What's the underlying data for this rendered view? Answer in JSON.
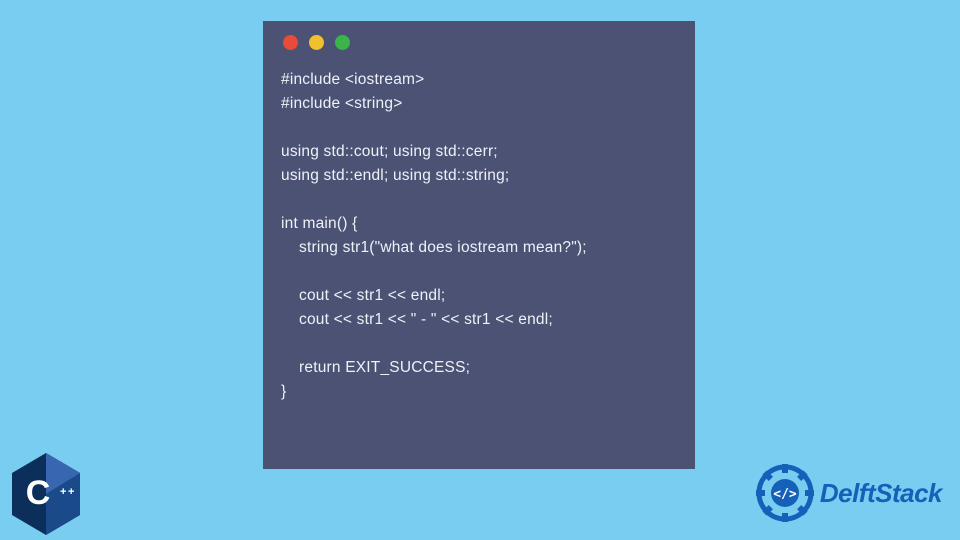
{
  "window": {
    "dots": [
      "red",
      "yellow",
      "green"
    ]
  },
  "code": {
    "lines": [
      "#include <iostream>",
      "#include <string>",
      "",
      "using std::cout; using std::cerr;",
      "using std::endl; using std::string;",
      "",
      "int main() {",
      "    string str1(\"what does iostream mean?\");",
      "",
      "    cout << str1 << endl;",
      "    cout << str1 << \" - \" << str1 << endl;",
      "",
      "    return EXIT_SUCCESS;",
      "}"
    ]
  },
  "badges": {
    "cpp_label": "C",
    "cpp_plus": "++",
    "delft_brand": "DelftStack"
  },
  "colors": {
    "bg": "#78cdf0",
    "window": "#4b5274",
    "code_text": "#eef1f7",
    "cpp_blue_dark": "#0b2e5a",
    "cpp_blue_light": "#3966b0",
    "delft_blue": "#1560b8"
  }
}
